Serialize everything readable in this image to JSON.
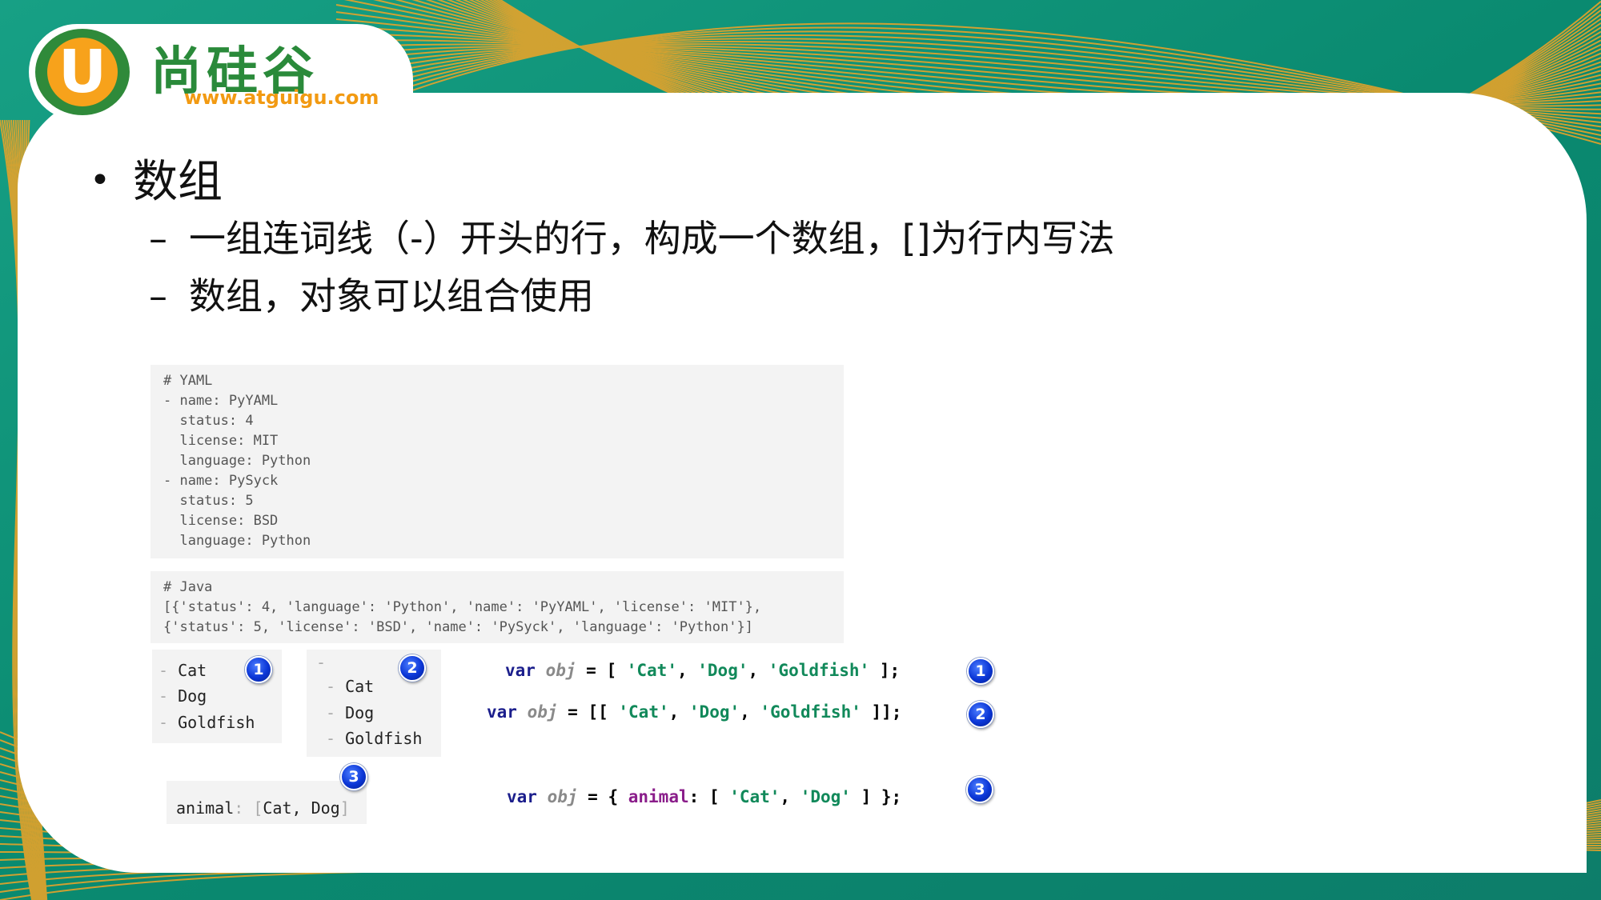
{
  "logo": {
    "letter": "U",
    "name": "尚硅谷",
    "url": "www.atguigu.com"
  },
  "bullet": "数组",
  "sub_items": [
    "一组连词线（-）开头的行，构成一个数组，[]为行内写法",
    "数组，对象可以组合使用"
  ],
  "yaml_block": "# YAML\n- name: PyYAML\n  status: 4\n  license: MIT\n  language: Python\n- name: PySyck\n  status: 5\n  license: BSD\n  language: Python",
  "java_block": "# Java\n[{'status': 4, 'language': 'Python', 'name': 'PyYAML', 'license': 'MIT'},\n{'status': 5, 'license': 'BSD', 'name': 'PySyck', 'language': 'Python'}]",
  "list1": {
    "items": [
      "Cat",
      "Dog",
      "Goldfish"
    ],
    "marker": "-"
  },
  "list2": {
    "parent": "-",
    "items": [
      "Cat",
      "Dog",
      "Goldfish"
    ],
    "marker": "-"
  },
  "inline": {
    "key": "animal",
    "sep": ":",
    "open": "[",
    "value": "Cat, Dog",
    "close": "]"
  },
  "badges": {
    "one": "1",
    "two": "2",
    "three": "3"
  },
  "js": {
    "kw": "var",
    "obj": "obj",
    "l1_open": " = [ ",
    "l1_close": " ];",
    "l2_open": " = [[ ",
    "l2_close": " ]];",
    "l3_open": " = { ",
    "l3_key": "animal",
    "l3_mid": ": [ ",
    "l3_close": " ] };",
    "comma": ", ",
    "cat": "'Cat'",
    "dog": "'Dog'",
    "goldfish": "'Goldfish'"
  },
  "colors": {
    "teal": "#0f8f78",
    "orange": "#f7a21b",
    "green": "#2f8a3a",
    "badge_blue": "#0b36d6"
  }
}
